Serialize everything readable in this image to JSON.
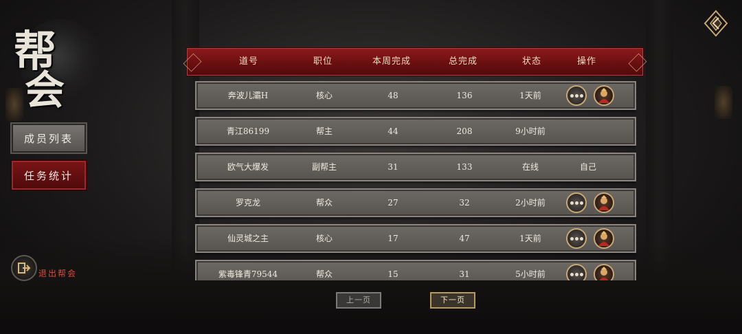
{
  "title": {
    "line1": "帮",
    "line2": "会"
  },
  "sidebar": {
    "members_label": "成员列表",
    "tasks_label": "任务统计",
    "exit_label": "退出帮会"
  },
  "header": {
    "name": "道号",
    "role": "职位",
    "weekly": "本周完成",
    "total": "总完成",
    "status": "状态",
    "action": "操作"
  },
  "rows": [
    {
      "name": "奔波儿灞H",
      "role": "核心",
      "weekly": "48",
      "total": "136",
      "status": "1天前",
      "action": "",
      "ops": true
    },
    {
      "name": "青江86199",
      "role": "帮主",
      "weekly": "44",
      "total": "208",
      "status": "9小时前",
      "action": "",
      "ops": false
    },
    {
      "name": "欧气大爆发",
      "role": "副帮主",
      "weekly": "31",
      "total": "133",
      "status": "在线",
      "action": "自己",
      "ops": false
    },
    {
      "name": "罗克龙",
      "role": "帮众",
      "weekly": "27",
      "total": "32",
      "status": "2小时前",
      "action": "",
      "ops": true
    },
    {
      "name": "仙灵城之主",
      "role": "核心",
      "weekly": "17",
      "total": "47",
      "status": "1天前",
      "action": "",
      "ops": true
    },
    {
      "name": "紫毒锋青79544",
      "role": "帮众",
      "weekly": "15",
      "total": "31",
      "status": "5小时前",
      "action": "",
      "ops": true
    }
  ],
  "pagination": {
    "prev_label": "上一页",
    "next_label": "下一页"
  },
  "colors": {
    "header_red": "#8c1a1c",
    "active_tab": "#7a1416",
    "exit_text": "#e04a3a",
    "gold_border": "#c8a874"
  }
}
